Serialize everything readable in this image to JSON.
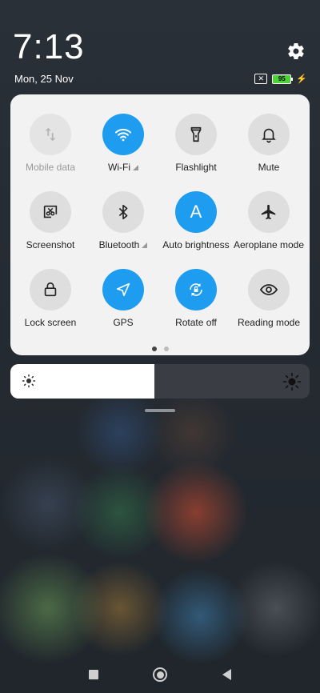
{
  "status": {
    "time": "7:13",
    "date": "Mon, 25 Nov",
    "battery": "95"
  },
  "tiles": [
    {
      "label": "Mobile data",
      "icon": "mobile-data-icon",
      "active": false,
      "dim": true
    },
    {
      "label": "Wi-Fi",
      "icon": "wifi-icon",
      "active": true
    },
    {
      "label": "Flashlight",
      "icon": "flashlight-icon",
      "active": false
    },
    {
      "label": "Mute",
      "icon": "bell-icon",
      "active": false
    },
    {
      "label": "Screenshot",
      "icon": "screenshot-icon",
      "active": false
    },
    {
      "label": "Bluetooth",
      "icon": "bluetooth-icon",
      "active": false
    },
    {
      "label": "Auto brightness",
      "icon": "auto-brightness-icon",
      "active": true
    },
    {
      "label": "Aeroplane mode",
      "icon": "airplane-icon",
      "active": false
    },
    {
      "label": "Lock screen",
      "icon": "lock-icon",
      "active": false
    },
    {
      "label": "GPS",
      "icon": "location-arrow-icon",
      "active": true
    },
    {
      "label": "Rotate off",
      "icon": "rotate-lock-icon",
      "active": true
    },
    {
      "label": "Reading mode",
      "icon": "eye-icon",
      "active": false
    }
  ],
  "auto_brightness_glyph": "A",
  "pager": {
    "pages": 2,
    "current": 1
  },
  "brightness": {
    "level": 0.48
  },
  "colors": {
    "accent": "#1e9cf0",
    "panel": "#f2f2f2"
  }
}
